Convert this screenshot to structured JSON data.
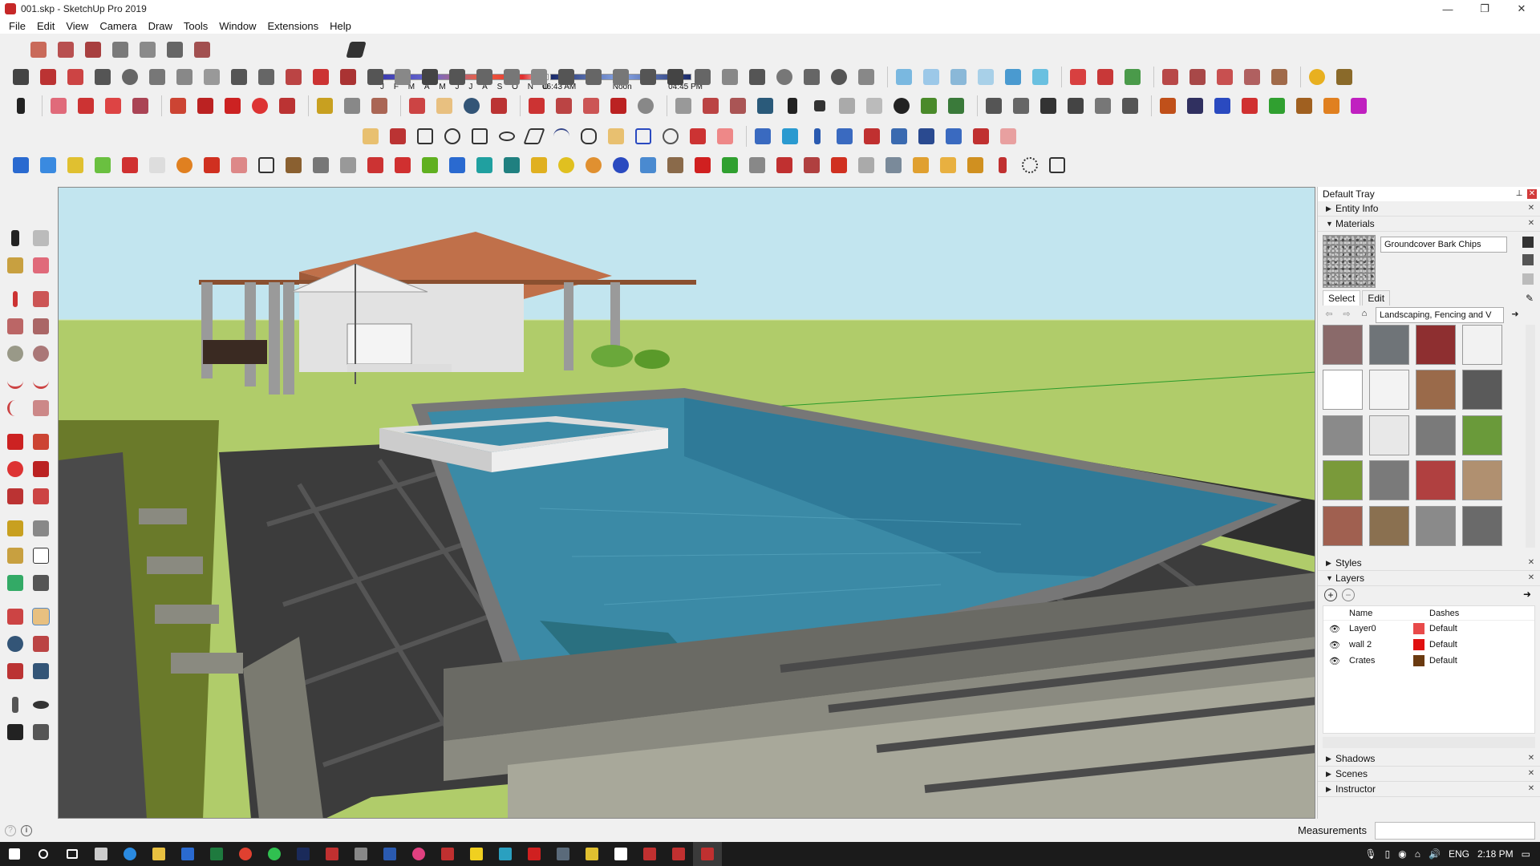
{
  "window": {
    "title": "001.skp - SketchUp Pro 2019",
    "controls": [
      "—",
      "❐",
      "✕"
    ]
  },
  "menu": [
    "File",
    "Edit",
    "View",
    "Camera",
    "Draw",
    "Tools",
    "Window",
    "Extensions",
    "Help"
  ],
  "shadow": {
    "months": [
      "J",
      "F",
      "M",
      "A",
      "M",
      "J",
      "J",
      "A",
      "S",
      "O",
      "N",
      "D"
    ],
    "sunrise": "06:43 AM",
    "noon": "Noon",
    "sunset": "04:45 PM"
  },
  "tray": {
    "title": "Default Tray",
    "entity_info": "Entity Info",
    "materials": {
      "header": "Materials",
      "current_name": "Groundcover Bark Chips",
      "tabs": [
        "Select",
        "Edit"
      ],
      "library": "Landscaping, Fencing and V",
      "swatches": [
        "#8a6a6a",
        "#6f7478",
        "#8e2f30",
        "#f2f2f2",
        "#ffffff",
        "#f3f3f3",
        "#9a6a4a",
        "#5a5a5a",
        "#8a8a8a",
        "#e8e8e8",
        "#7a7a7a",
        "#6a9a3a",
        "#7a9a3a",
        "#7a7a7a",
        "#b04040",
        "#b09070",
        "#a06050",
        "#8a7050",
        "#8a8a8a",
        "#6a6a6a"
      ]
    },
    "styles": "Styles",
    "layers": {
      "header": "Layers",
      "col_name": "Name",
      "col_dashes": "Dashes",
      "rows": [
        {
          "name": "Layer0",
          "color": "#e84a4a",
          "dashes": "Default"
        },
        {
          "name": "wall 2",
          "color": "#e01010",
          "dashes": "Default"
        },
        {
          "name": "Crates",
          "color": "#6a3a10",
          "dashes": "Default"
        }
      ]
    },
    "shadows": "Shadows",
    "scenes": "Scenes",
    "instructor": "Instructor"
  },
  "status": {
    "measurements_label": "Measurements"
  },
  "taskbar": {
    "language": "ENG",
    "time": "2:18 PM"
  }
}
